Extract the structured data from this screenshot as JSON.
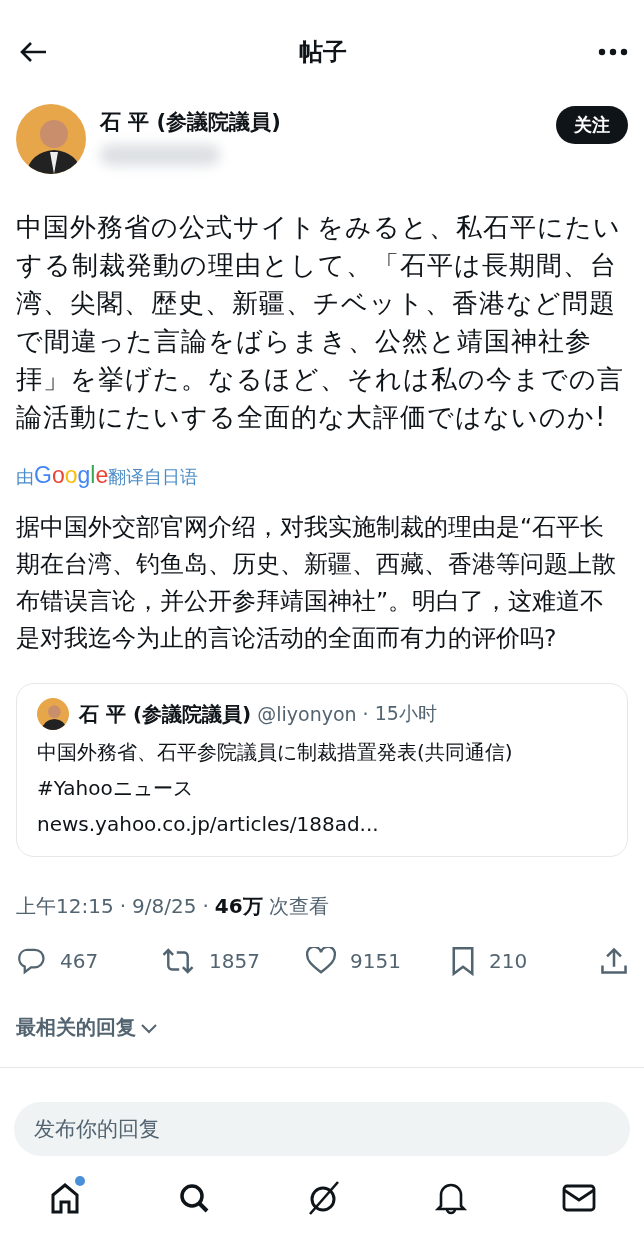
{
  "header": {
    "title": "帖子"
  },
  "author": {
    "name": "石 平 (参議院議員)",
    "follow_label": "关注"
  },
  "post": {
    "text": "中国外務省の公式サイトをみると、私石平にたいする制裁発動の理由として、「石平は長期間、台湾、尖閣、歴史、新疆、チベット、香港など問題で間違った言論をばらまき、公然と靖国神社参拝」を挙げた。なるほど、それは私の今までの言論活動にたいする全面的な大評価ではないのか!",
    "translation_prefix": "由",
    "translation_brand": "Google",
    "translation_suffix": "翻译自日语",
    "translated_text": "据中国外交部官网介绍，对我实施制裁的理由是“石平长期在台湾、钓鱼岛、历史、新疆、西藏、香港等问题上散布错误言论，并公开参拜靖国神社”。明白了，这难道不是对我迄今为止的言论活动的全面而有力的评价吗?"
  },
  "quote": {
    "name": "石 平 (参議院議員)",
    "handle": "@liyonyon",
    "separator": "·",
    "time": "15小时",
    "lines": [
      "中国外務省、石平参院議員に制裁措置発表(共同通信)",
      "#Yahooニュース",
      "news.yahoo.co.jp/articles/188ad..."
    ]
  },
  "meta": {
    "time": "上午12:15",
    "separator_1": "·",
    "date": "9/8/25",
    "separator_2": "·",
    "views": "46万",
    "views_label": "次查看"
  },
  "actions": [
    {
      "kind": "reply",
      "count": "467"
    },
    {
      "kind": "repost",
      "count": "1857"
    },
    {
      "kind": "like",
      "count": "9151"
    },
    {
      "kind": "bookmark",
      "count": "210"
    },
    {
      "kind": "share"
    }
  ],
  "replies_sort": "最相关的回复",
  "reply_field": {
    "placeholder": "发布你的回复"
  },
  "nav": [
    {
      "kind": "home",
      "selected": true,
      "badge": true
    },
    {
      "kind": "search",
      "selected": false,
      "badge": false
    },
    {
      "kind": "grok",
      "selected": false,
      "badge": false
    },
    {
      "kind": "notifications",
      "selected": false,
      "badge": false
    },
    {
      "kind": "messages",
      "selected": false,
      "badge": false
    }
  ]
}
